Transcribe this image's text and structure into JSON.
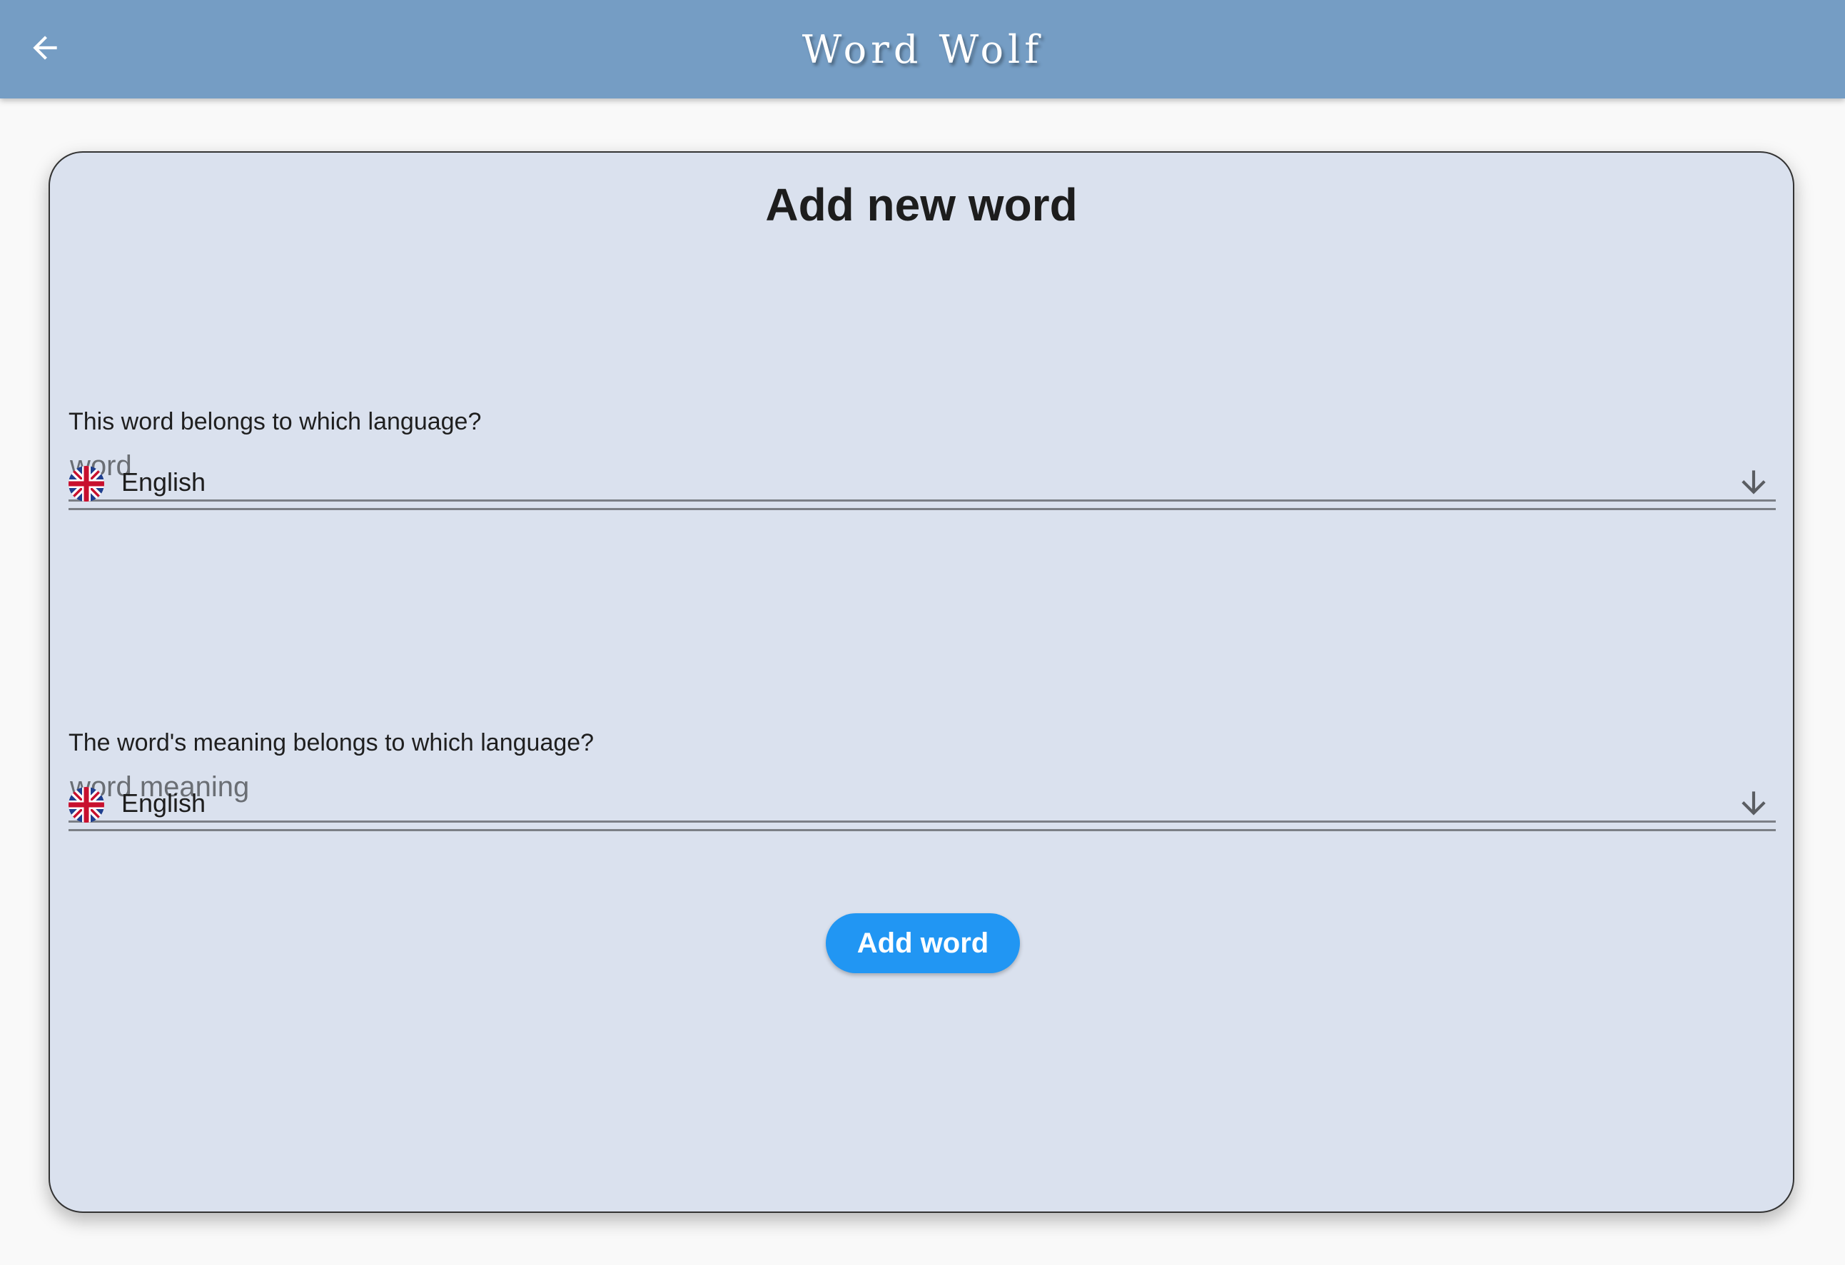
{
  "app": {
    "title": "Word Wolf",
    "back_icon": "arrow-left-icon"
  },
  "form": {
    "heading": "Add new word",
    "word_field": {
      "placeholder": "word",
      "value": ""
    },
    "word_language": {
      "label": "This word belongs to which language?",
      "selected": "English",
      "flag_icon": "uk-flag-icon",
      "arrow_icon": "arrow-down-icon"
    },
    "meaning_field": {
      "placeholder": "word meaning",
      "value": ""
    },
    "meaning_language": {
      "label": "The word's meaning belongs to which language?",
      "selected": "English",
      "flag_icon": "uk-flag-icon",
      "arrow_icon": "arrow-down-icon"
    },
    "submit_label": "Add word"
  },
  "colors": {
    "appbar": "#759dc4",
    "card": "#dae1ee",
    "button": "#2196f3"
  }
}
